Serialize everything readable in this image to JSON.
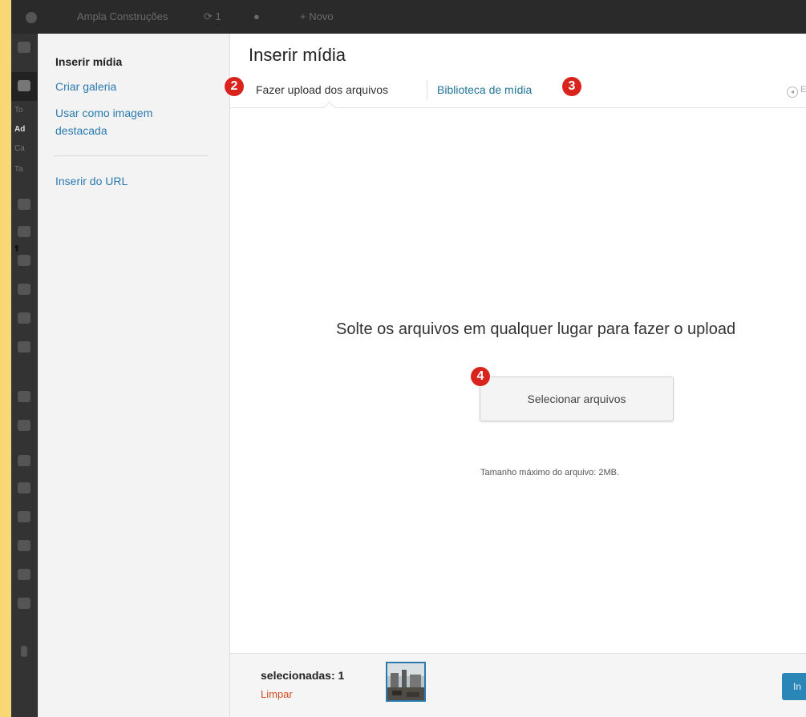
{
  "admin_bar": {
    "site_name": "Ampla Construções",
    "updates_count": "1",
    "new_label": "Novo"
  },
  "wp_sidebar": {
    "sub_items": [
      "To",
      "Ad",
      "Ca",
      "Ta"
    ]
  },
  "stray_mark": ",",
  "modal": {
    "menu": {
      "items": [
        "Inserir mídia",
        "Criar galeria",
        "Usar como imagem destacada",
        "Inserir do URL"
      ]
    },
    "title": "Inserir mídia",
    "tabs": [
      "Fazer upload dos arquivos",
      "Biblioteca de mídia"
    ],
    "nav_back_glyph": "◂",
    "nav_back_text": "E",
    "uploader": {
      "drop_message": "Solte os arquivos em qualquer lugar para fazer o upload",
      "select_button": "Selecionar arquivos",
      "max_size": "Tamanho máximo do arquivo: 2MB."
    },
    "toolbar": {
      "selection_count": "selecionadas: 1",
      "clear_link": "Limpar",
      "insert_button": "In"
    }
  },
  "callouts": [
    "2",
    "3",
    "4"
  ],
  "colors": {
    "accent_yellow": "#f7d875",
    "link_blue": "#21759b",
    "callout_red": "#d8241c",
    "clear_red": "#d54e21",
    "primary_button": "#2b86b8"
  }
}
